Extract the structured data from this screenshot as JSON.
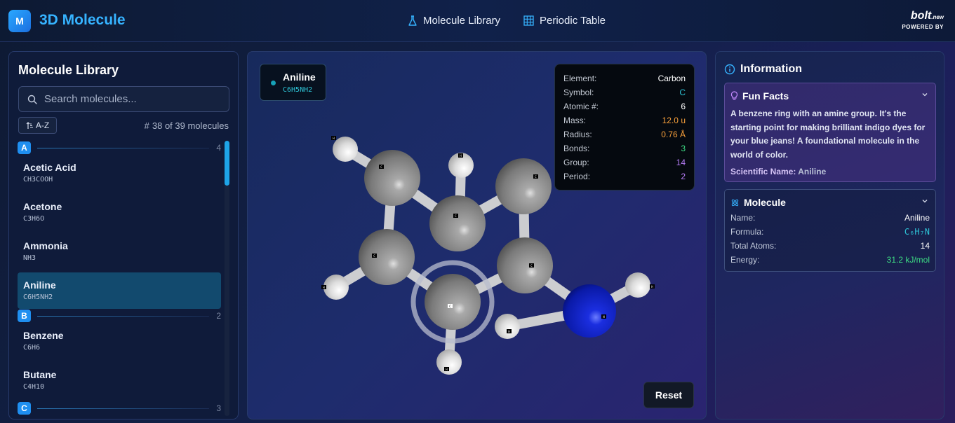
{
  "header": {
    "logo_letter": "M",
    "app_title": "3D Molecule",
    "nav": {
      "library": "Molecule Library",
      "periodic": "Periodic Table"
    },
    "bolt": {
      "brand": "bolt",
      "suffix": ".new",
      "powered": "POWERED BY"
    }
  },
  "library": {
    "title": "Molecule Library",
    "search_placeholder": "Search molecules...",
    "sort_label": "A-Z",
    "count_text": "38 of 39 molecules",
    "groups": [
      {
        "letter": "A",
        "count": "4",
        "items": [
          {
            "name": "Acetic Acid",
            "formula": "CH3COOH"
          },
          {
            "name": "Acetone",
            "formula": "C3H6O"
          },
          {
            "name": "Ammonia",
            "formula": "NH3"
          },
          {
            "name": "Aniline",
            "formula": "C6H5NH2",
            "active": true
          }
        ]
      },
      {
        "letter": "B",
        "count": "2",
        "items": [
          {
            "name": "Benzene",
            "formula": "C6H6"
          },
          {
            "name": "Butane",
            "formula": "C4H10"
          }
        ]
      },
      {
        "letter": "C",
        "count": "3",
        "items": []
      }
    ]
  },
  "viewer": {
    "badge_name": "Aniline",
    "badge_formula": "C6H5NH2",
    "atom_label": {
      "C": "C",
      "H": "H",
      "N": "N"
    },
    "tooltip": [
      {
        "k": "Element:",
        "v": "Carbon",
        "color": "#ffffff"
      },
      {
        "k": "Symbol:",
        "v": "C",
        "color": "#2ec4d6"
      },
      {
        "k": "Atomic #:",
        "v": "6",
        "color": "#ffffff"
      },
      {
        "k": "Mass:",
        "v": "12.0 u",
        "color": "#f59e3b"
      },
      {
        "k": "Radius:",
        "v": "0.76 Å",
        "color": "#f59e3b"
      },
      {
        "k": "Bonds:",
        "v": "3",
        "color": "#3ddc84"
      },
      {
        "k": "Group:",
        "v": "14",
        "color": "#b57cf5"
      },
      {
        "k": "Period:",
        "v": "2",
        "color": "#b57cf5"
      }
    ],
    "reset_label": "Reset"
  },
  "info": {
    "title": "Information",
    "fun_facts": {
      "title": "Fun Facts",
      "text": "A benzene ring with an amine group. It's the starting point for making brilliant indigo dyes for your blue jeans! A foundational molecule in the world of color.",
      "sci_label": "Scientific Name:",
      "sci_value": "Aniline"
    },
    "molecule": {
      "title": "Molecule",
      "rows": [
        {
          "k": "Name:",
          "v": "Aniline",
          "color": "#ffffff"
        },
        {
          "k": "Formula:",
          "v": "C₆H₇N",
          "color": "#2ec4d6"
        },
        {
          "k": "Total Atoms:",
          "v": "14",
          "color": "#ffffff"
        },
        {
          "k": "Energy:",
          "v": "31.2 kJ/mol",
          "color": "#3ddc84"
        }
      ]
    }
  }
}
